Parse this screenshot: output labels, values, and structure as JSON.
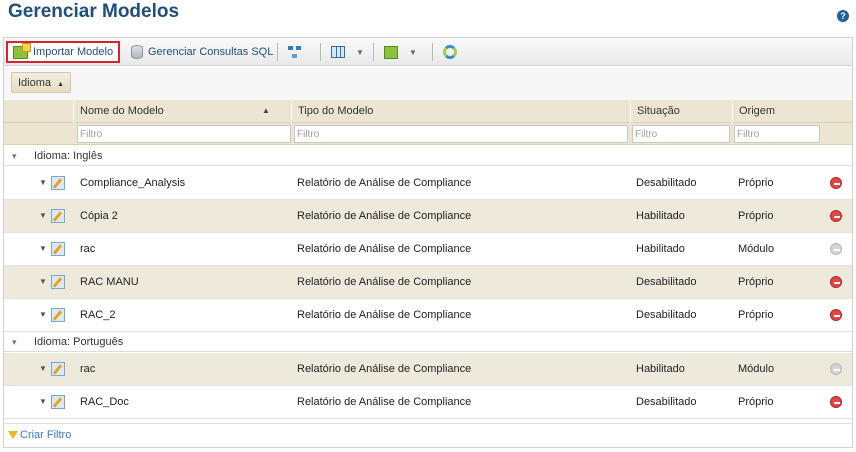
{
  "page": {
    "title": "Gerenciar Modelos",
    "help_icon": "?"
  },
  "toolbar": {
    "import_label": "Importar Modelo",
    "sql_label": "Gerenciar Consultas SQL",
    "icons": [
      "import-icon",
      "database-icon",
      "hierarchy-icon",
      "columns-icon",
      "export-icon",
      "refresh-icon"
    ]
  },
  "grouping": {
    "chip_label": "Idioma",
    "sort_glyph": "▲"
  },
  "columns": {
    "name": "Nome do Modelo",
    "type": "Tipo do Modelo",
    "status": "Situação",
    "origin": "Origem"
  },
  "filters": {
    "placeholder": "Filtro"
  },
  "groups": [
    {
      "label": "Idioma: Inglês",
      "rows": [
        {
          "name": "Compliance_Analysis",
          "type": "Relatório de Análise de Compliance",
          "status": "Desabilitado",
          "origin": "Próprio",
          "action": "delete"
        },
        {
          "name": "Cópia 2",
          "type": "Relatório de Análise de Compliance",
          "status": "Habilitado",
          "origin": "Próprio",
          "action": "delete"
        },
        {
          "name": "rac",
          "type": "Relatório de Análise de Compliance",
          "status": "Habilitado",
          "origin": "Módulo",
          "action": "disabled"
        },
        {
          "name": "RAC MANU",
          "type": "Relatório de Análise de Compliance",
          "status": "Desabilitado",
          "origin": "Próprio",
          "action": "delete"
        },
        {
          "name": "RAC_2",
          "type": "Relatório de Análise de Compliance",
          "status": "Desabilitado",
          "origin": "Próprio",
          "action": "delete"
        }
      ]
    },
    {
      "label": "Idioma: Português",
      "rows": [
        {
          "name": "rac",
          "type": "Relatório de Análise de Compliance",
          "status": "Habilitado",
          "origin": "Módulo",
          "action": "disabled"
        },
        {
          "name": "RAC_Doc",
          "type": "Relatório de Análise de Compliance",
          "status": "Desabilitado",
          "origin": "Próprio",
          "action": "delete"
        }
      ]
    }
  ],
  "footer": {
    "create_filter_label": "Criar Filtro"
  },
  "colors": {
    "title": "#1f4f7a",
    "row_alt": "#eeeadb",
    "header": "#ece5d1",
    "delete": "#e04848",
    "highlight_border": "#d9232a"
  }
}
